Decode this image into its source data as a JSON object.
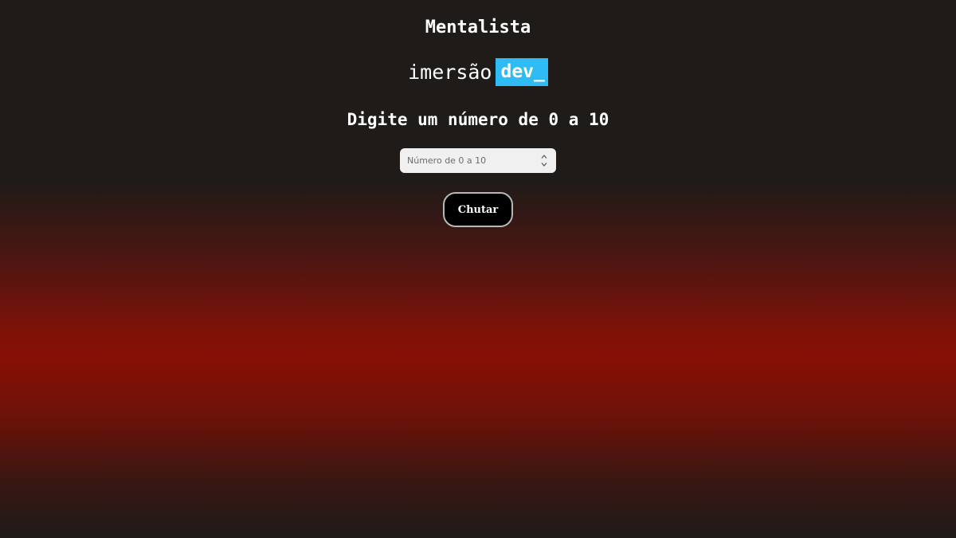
{
  "page": {
    "title": "Mentalista",
    "background_colors": [
      "#1e1b18",
      "#861006"
    ]
  },
  "logo": {
    "text": "imersão",
    "badge": "dev_",
    "badge_color": "#2fbcf5"
  },
  "prompt": "Digite um número de 0 a 10",
  "input": {
    "placeholder": "Número de 0 a 10",
    "value": "",
    "spinner_icons": [
      "chevron-up-icon",
      "chevron-down-icon"
    ]
  },
  "button": {
    "label": "Chutar"
  }
}
